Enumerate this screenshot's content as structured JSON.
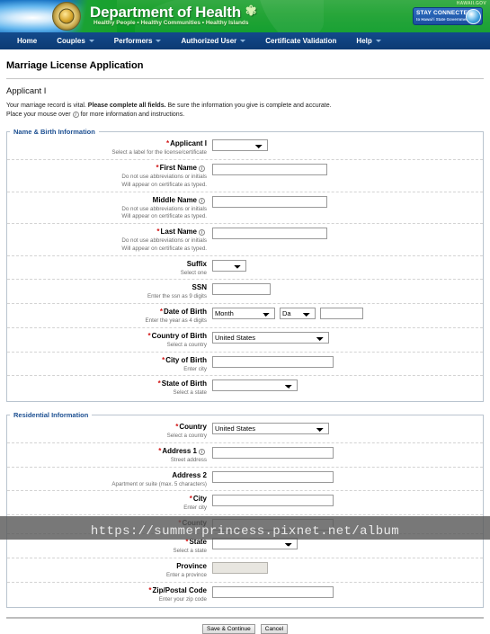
{
  "banner": {
    "department_title": "Department of Health",
    "logo_glyph": "✾",
    "tagline": "Healthy People • Healthy Communities • Healthy Islands",
    "hawaii_gov": "HAWAII.GOV",
    "stay_connected_title": "STAY CONNECTED",
    "stay_connected_sub": "to Hawai‘i State Government",
    "colors": {
      "green": "#18a02c",
      "navy": "#0c3a73",
      "blue": "#1a74c4"
    }
  },
  "nav": {
    "items": [
      {
        "label": "Home",
        "has_caret": false
      },
      {
        "label": "Couples",
        "has_caret": true
      },
      {
        "label": "Performers",
        "has_caret": true
      },
      {
        "label": "Authorized User",
        "has_caret": true
      },
      {
        "label": "Certificate Validation",
        "has_caret": false
      },
      {
        "label": "Help",
        "has_caret": true
      }
    ]
  },
  "page": {
    "title": "Marriage License Application",
    "applicant_heading": "Applicant I",
    "intro_line1_a": "Your marriage record is vital. ",
    "intro_line1_b": "Please complete all fields.",
    "intro_line1_c": " Be sure the information you give is complete and accurate.",
    "intro_line2_a": "Place your mouse over",
    "intro_line2_b": "for more information and instructions."
  },
  "name_birth": {
    "legend": "Name & Birth Information",
    "fields": [
      {
        "label": "Applicant I",
        "required": true,
        "info": false,
        "help": "Select a label for the license/certificate",
        "type": "select",
        "value": ""
      },
      {
        "label": "First Name",
        "required": true,
        "info": true,
        "help": "Do not use abbreviations or initials\nWill appear on certificate as typed.",
        "type": "text",
        "value": ""
      },
      {
        "label": "Middle Name",
        "required": false,
        "info": true,
        "help": "Do not use abbreviations or initials\nWill appear on certificate as typed.",
        "type": "text",
        "value": ""
      },
      {
        "label": "Last Name",
        "required": true,
        "info": true,
        "help": "Do not use abbreviations or initials\nWill appear on certificate as typed.",
        "type": "text",
        "value": ""
      },
      {
        "label": "Suffix",
        "required": false,
        "info": false,
        "help": "Select one",
        "type": "select",
        "value": ""
      },
      {
        "label": "SSN",
        "required": false,
        "info": false,
        "help": "Enter the ssn as 9 digits",
        "type": "text",
        "value": ""
      },
      {
        "label": "Date of Birth",
        "required": true,
        "info": false,
        "help": "Enter the year as 4 digits",
        "type": "date",
        "month_value": "Month",
        "day_value": "Da",
        "year_value": ""
      },
      {
        "label": "Country of Birth",
        "required": true,
        "info": false,
        "help": "Select a country",
        "type": "select",
        "value": "United States"
      },
      {
        "label": "City of Birth",
        "required": true,
        "info": false,
        "help": "Enter city",
        "type": "text",
        "value": ""
      },
      {
        "label": "State of Birth",
        "required": true,
        "info": false,
        "help": "Select a state",
        "type": "select",
        "value": ""
      }
    ]
  },
  "residential": {
    "legend": "Residential Information",
    "fields": [
      {
        "label": "Country",
        "required": true,
        "info": false,
        "help": "Select a country",
        "type": "select",
        "value": "United States"
      },
      {
        "label": "Address 1",
        "required": true,
        "info": true,
        "help": "Street address",
        "type": "text",
        "value": ""
      },
      {
        "label": "Address 2",
        "required": false,
        "info": false,
        "help": "Apartment or suite (max. 5 characters)",
        "type": "text",
        "value": ""
      },
      {
        "label": "City",
        "required": true,
        "info": false,
        "help": "Enter city",
        "type": "text",
        "value": ""
      },
      {
        "label": "County",
        "required": true,
        "info": false,
        "help": "",
        "type": "text",
        "value": ""
      },
      {
        "label": "State",
        "required": true,
        "info": false,
        "help": "Select a state",
        "type": "select",
        "value": ""
      },
      {
        "label": "Province",
        "required": false,
        "info": false,
        "help": "Enter a province",
        "type": "text",
        "value": "",
        "disabled": true
      },
      {
        "label": "Zip/Postal Code",
        "required": true,
        "info": false,
        "help": "Enter your zip code",
        "type": "text",
        "value": ""
      }
    ]
  },
  "footer": {
    "save_label": "Save & Continue",
    "cancel_label": "Cancel"
  },
  "watermark": {
    "url": "https://summerprincess.pixnet.net/album"
  }
}
